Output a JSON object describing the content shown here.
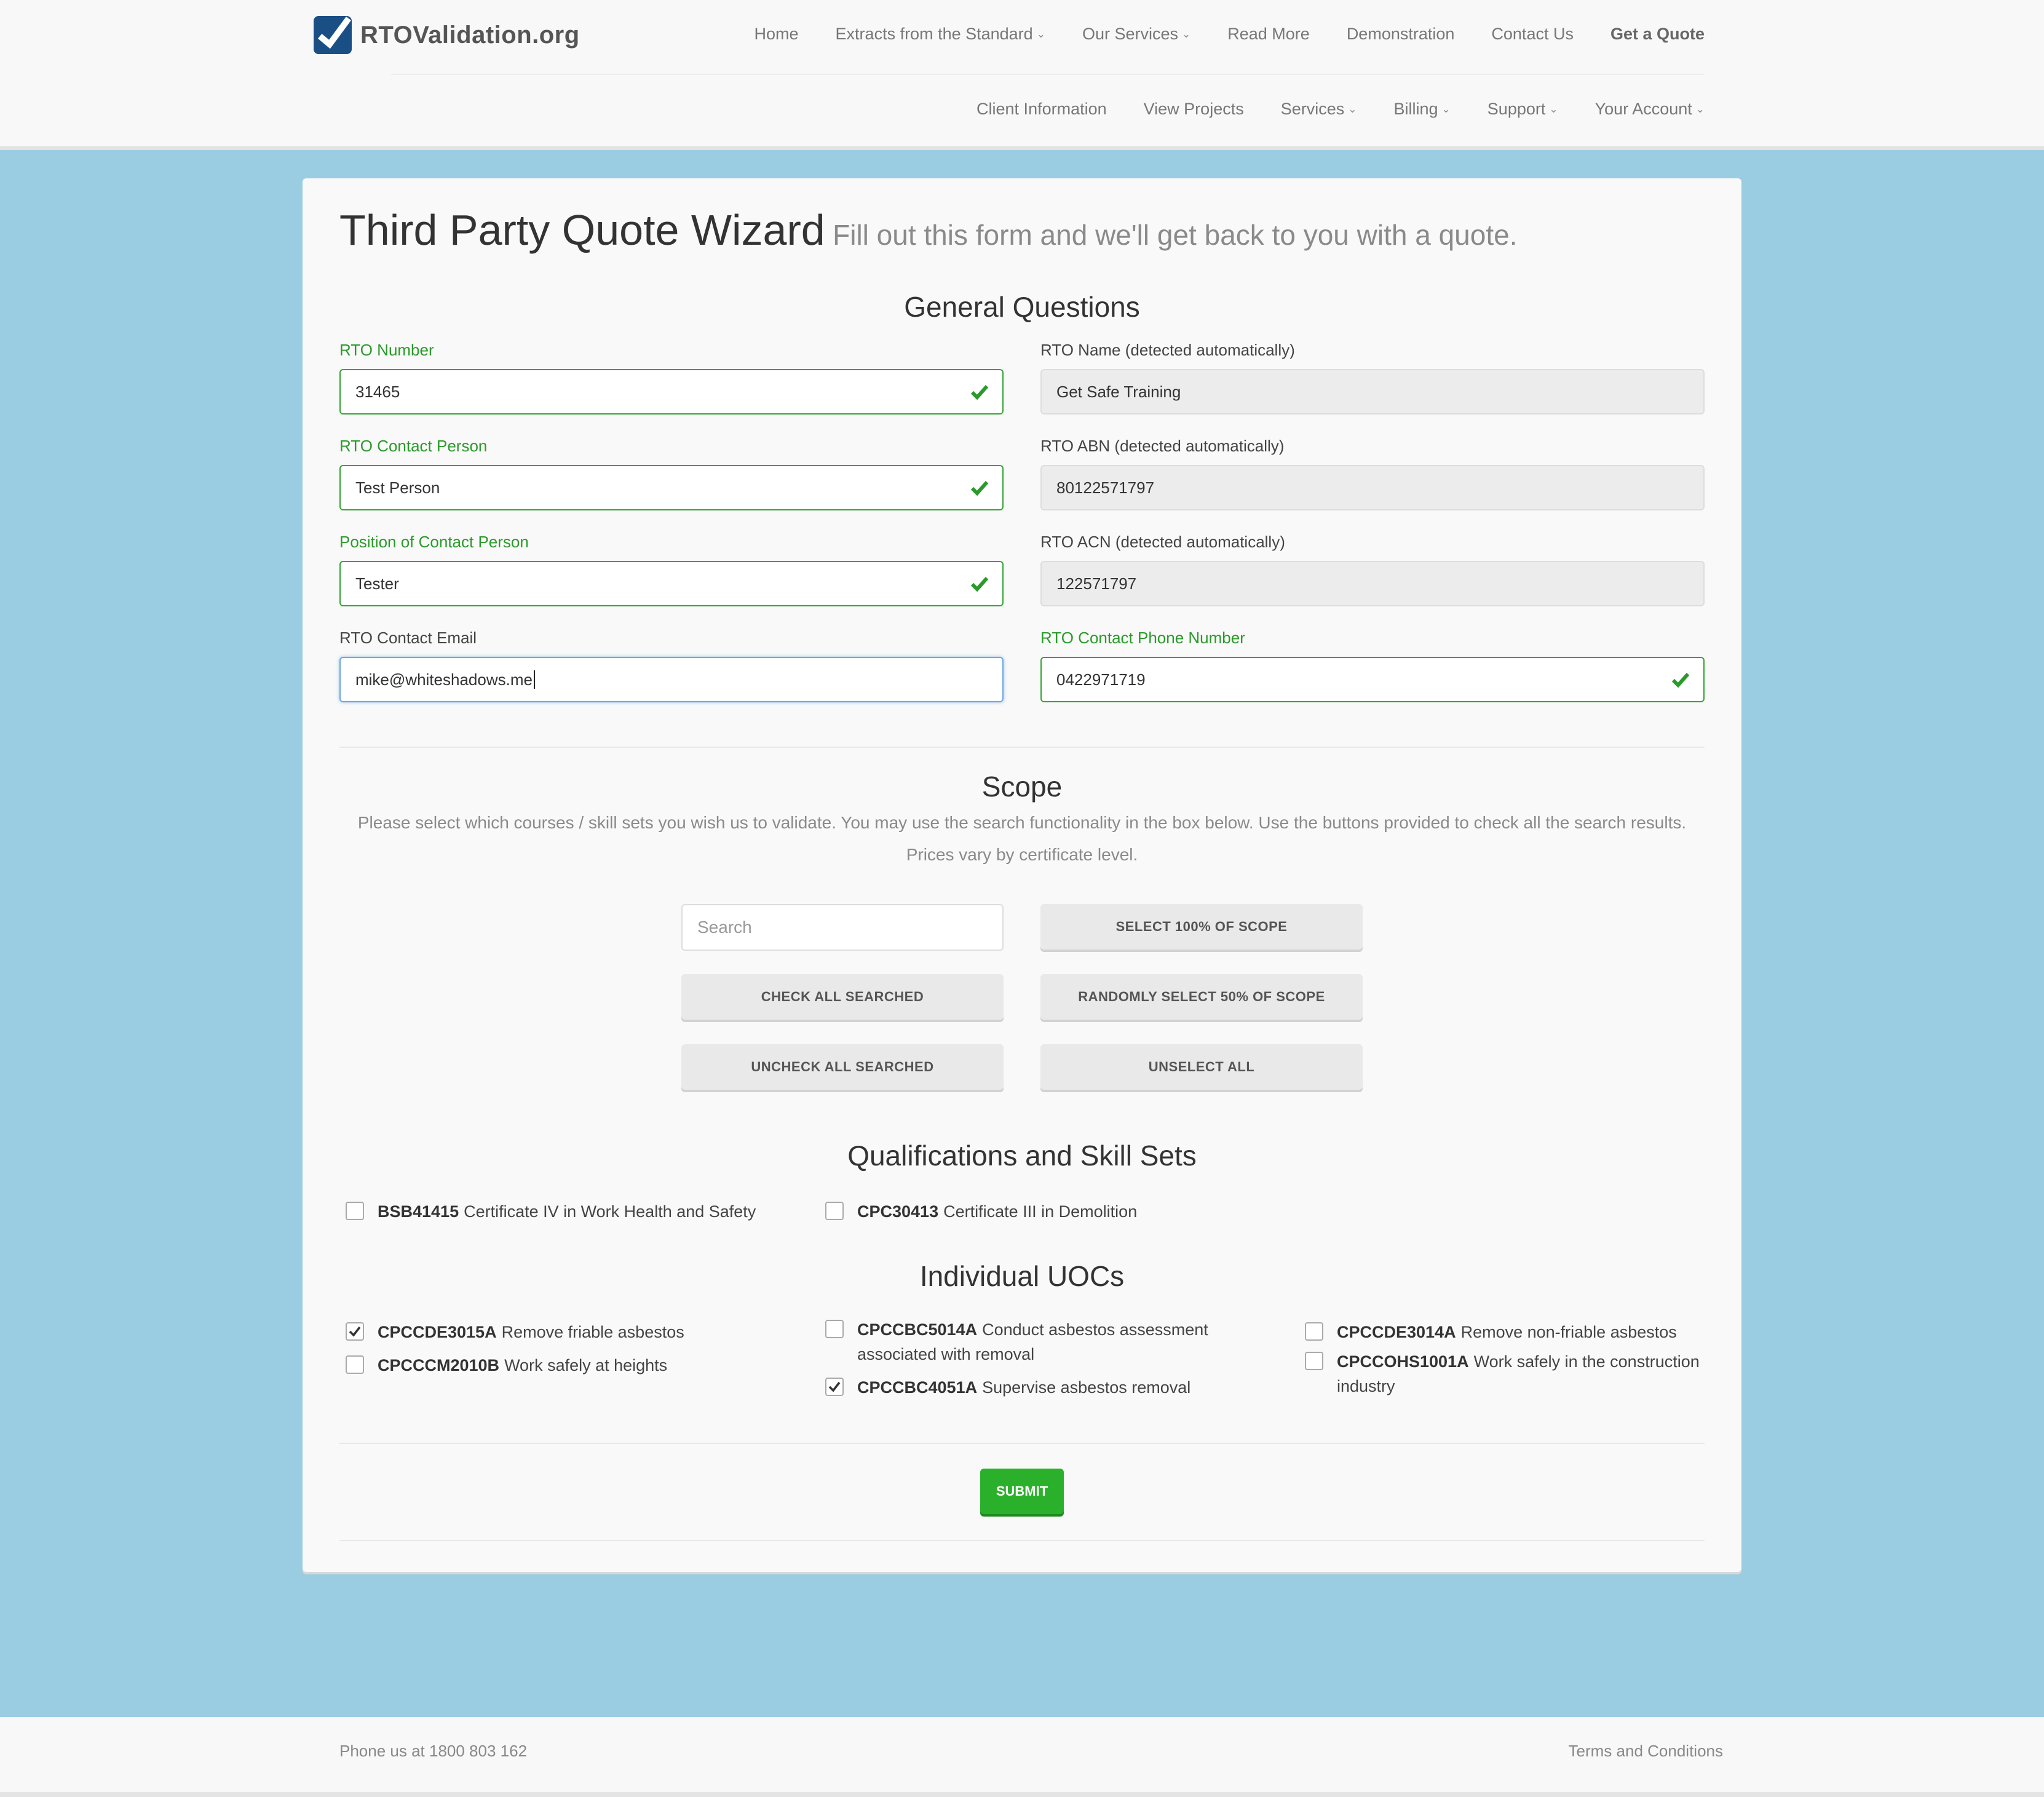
{
  "brand": {
    "name": "RTOValidation.org",
    "logo_color": "#1a4f86"
  },
  "nav": {
    "primary": [
      {
        "label": "Home",
        "has_dropdown": false,
        "bold": false
      },
      {
        "label": "Extracts from the Standard",
        "has_dropdown": true,
        "bold": false
      },
      {
        "label": "Our Services",
        "has_dropdown": true,
        "bold": false
      },
      {
        "label": "Read More",
        "has_dropdown": false,
        "bold": false
      },
      {
        "label": "Demonstration",
        "has_dropdown": false,
        "bold": false
      },
      {
        "label": "Contact Us",
        "has_dropdown": false,
        "bold": false
      },
      {
        "label": "Get a Quote",
        "has_dropdown": false,
        "bold": true
      }
    ],
    "secondary": [
      {
        "label": "Client Information",
        "has_dropdown": false
      },
      {
        "label": "View Projects",
        "has_dropdown": false
      },
      {
        "label": "Services",
        "has_dropdown": true
      },
      {
        "label": "Billing",
        "has_dropdown": true
      },
      {
        "label": "Support",
        "has_dropdown": true
      },
      {
        "label": "Your Account",
        "has_dropdown": true
      }
    ]
  },
  "page": {
    "title": "Third Party Quote Wizard",
    "subtitle": "Fill out this form and we'll get back to you with a quote."
  },
  "general": {
    "heading": "General Questions",
    "fields": {
      "rto_number": {
        "label": "RTO Number",
        "value": "31465"
      },
      "rto_name": {
        "label": "RTO Name (detected automatically)",
        "value": "Get Safe Training"
      },
      "contact_person": {
        "label": "RTO Contact Person",
        "value": "Test Person"
      },
      "rto_abn": {
        "label": "RTO ABN (detected automatically)",
        "value": "80122571797"
      },
      "position": {
        "label": "Position of Contact Person",
        "value": "Tester"
      },
      "rto_acn": {
        "label": "RTO ACN (detected automatically)",
        "value": "122571797"
      },
      "contact_email": {
        "label": "RTO Contact Email",
        "value": "mike@whiteshadows.me"
      },
      "contact_phone": {
        "label": "RTO Contact Phone Number",
        "value": "0422971719"
      }
    }
  },
  "scope": {
    "heading": "Scope",
    "description_line1": "Please select which courses / skill sets you wish us to validate. You may use the search functionality in the box below. Use the buttons provided to check all the search results.",
    "description_line2": "Prices vary by certificate level.",
    "search_placeholder": "Search",
    "buttons": {
      "select_100": "SELECT 100% OF SCOPE",
      "check_all": "CHECK ALL SEARCHED",
      "random_50": "RANDOMLY SELECT 50% OF SCOPE",
      "uncheck_all": "UNCHECK ALL SEARCHED",
      "unselect_all": "UNSELECT ALL"
    }
  },
  "qualifications": {
    "heading": "Qualifications and Skill Sets",
    "items": [
      {
        "code": "BSB41415",
        "name": "Certificate IV in Work Health and Safety",
        "checked": false
      },
      {
        "code": "CPC30413",
        "name": "Certificate III in Demolition",
        "checked": false
      }
    ]
  },
  "uocs": {
    "heading": "Individual UOCs",
    "items": [
      {
        "code": "CPCCDE3015A",
        "name": "Remove friable asbestos",
        "checked": true
      },
      {
        "code": "CPCCCM2010B",
        "name": "Work safely at heights",
        "checked": false
      },
      {
        "code": "CPCCBC5014A",
        "name": "Conduct asbestos assessment",
        "name2": "associated with removal",
        "checked": false
      },
      {
        "code": "CPCCBC4051A",
        "name": "Supervise asbestos removal",
        "checked": true
      },
      {
        "code": "CPCCDE3014A",
        "name": "Remove non-friable asbestos",
        "checked": false
      },
      {
        "code": "CPCCOHS1001A",
        "name": "Work safely in the construction",
        "name2": "industry",
        "checked": false
      }
    ]
  },
  "submit_label": "SUBMIT",
  "footer": {
    "phone": "Phone us at 1800 803 162",
    "terms": "Terms and Conditions"
  },
  "colors": {
    "page_bg": "#9bcde2",
    "valid_green": "#34a534",
    "submit_green": "#2bb02b",
    "focus_blue": "#6fa8dc"
  }
}
